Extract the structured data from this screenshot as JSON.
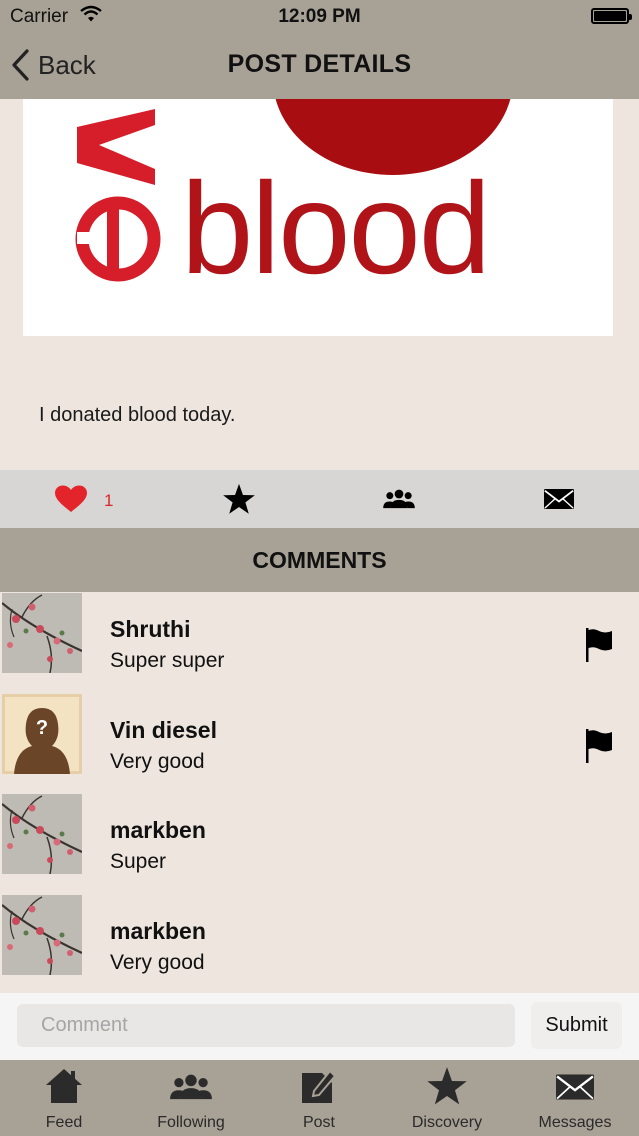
{
  "status_bar": {
    "carrier": "Carrier",
    "time": "12:09 PM"
  },
  "nav": {
    "back_label": "Back",
    "title": "POST DETAILS"
  },
  "post": {
    "image_logo_text": "veblood",
    "text": "I donated blood today.",
    "like_count": "1"
  },
  "actions": {
    "like_icon": "heart-icon",
    "favorite_icon": "star-icon",
    "share_icon": "group-icon",
    "message_icon": "envelope-icon",
    "like_color": "#e3242b"
  },
  "comments_header": "COMMENTS",
  "comments": [
    {
      "name": "Shruthi",
      "text": "Super super",
      "avatar": "floral-branch",
      "flag": true
    },
    {
      "name": "Vin diesel",
      "text": "Very good",
      "avatar": "unknown-person",
      "flag": true
    },
    {
      "name": "markben",
      "text": "Super",
      "avatar": "floral-branch",
      "flag": false
    },
    {
      "name": "markben",
      "text": "Very good",
      "avatar": "floral-branch",
      "flag": false
    }
  ],
  "comment_input": {
    "placeholder": "Comment",
    "value": "",
    "submit_label": "Submit"
  },
  "tabs": [
    {
      "label": "Feed",
      "icon": "home-icon"
    },
    {
      "label": "Following",
      "icon": "group-icon"
    },
    {
      "label": "Post",
      "icon": "edit-icon"
    },
    {
      "label": "Discovery",
      "icon": "star-icon"
    },
    {
      "label": "Messages",
      "icon": "envelope-icon"
    }
  ],
  "colors": {
    "bar_background": "#a8a195",
    "page_background": "#ede5de",
    "logo_red": "#b5161b"
  }
}
